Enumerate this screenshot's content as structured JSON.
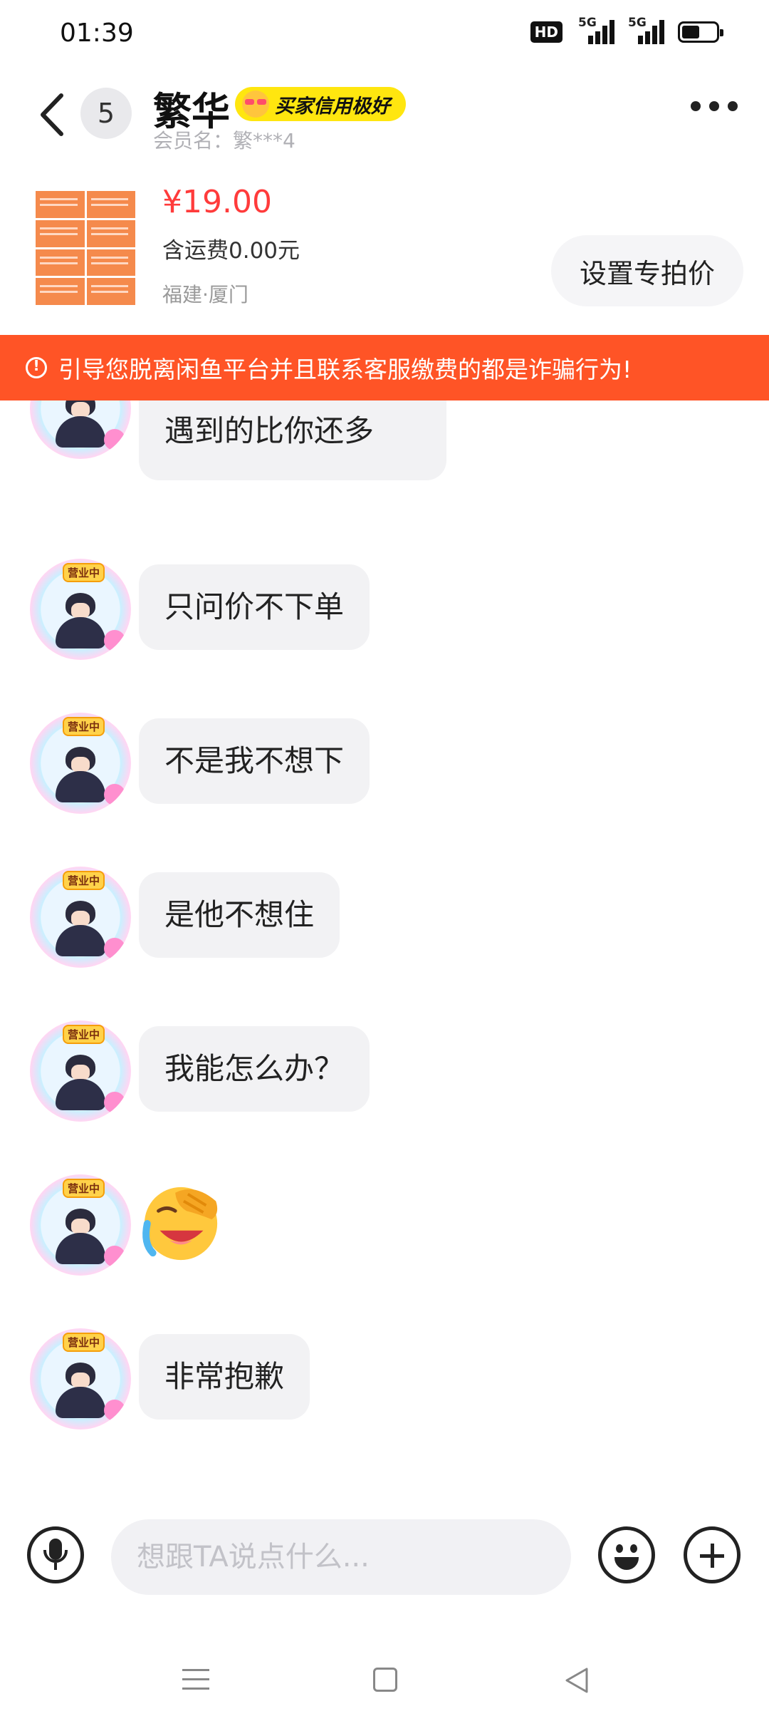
{
  "status_bar": {
    "time": "01:39",
    "hd_label": "HD",
    "network_1": "5G",
    "network_2": "5G",
    "battery_level": 0.55
  },
  "header": {
    "unread_count": "5",
    "contact_name": "繁华",
    "credit_badge": "买家信用极好",
    "member_label": "会员名：繁***4"
  },
  "product": {
    "price": "¥19.00",
    "shipping": "含运费0.00元",
    "location": "福建·厦门",
    "special_price_button": "设置专拍价"
  },
  "warning": {
    "text": "引导您脱离闲鱼平台并且联系客服缴费的都是诈骗行为!"
  },
  "avatar_tag": "营业中",
  "messages": [
    {
      "text": "像我这种顾客，我遇到的比你还多"
    },
    {
      "text": "只问价不下单"
    },
    {
      "text": "不是我不想下"
    },
    {
      "text": "是他不想住"
    },
    {
      "text": "我能怎么办？"
    },
    {
      "emoji": "crying-laughing-facepalm-emoji"
    },
    {
      "text": "非常抱歉"
    }
  ],
  "input": {
    "placeholder": "想跟TA说点什么..."
  }
}
